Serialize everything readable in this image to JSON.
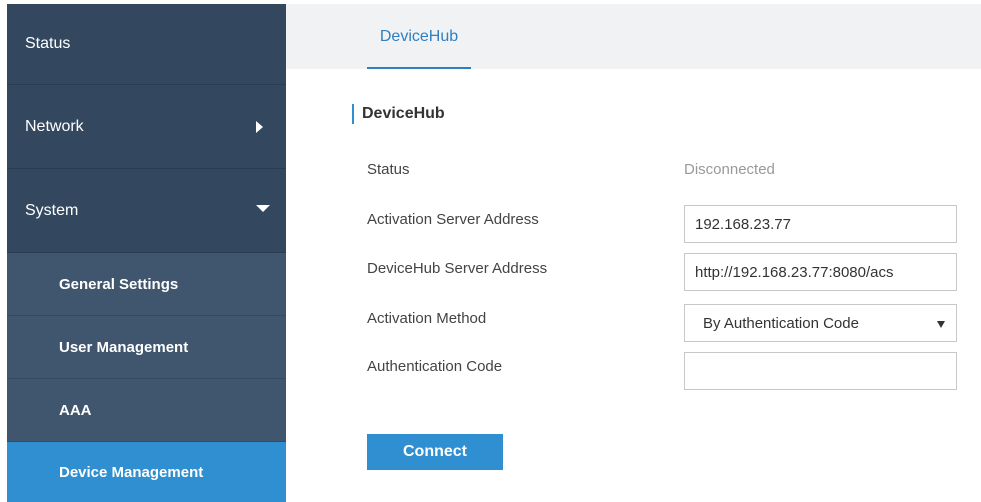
{
  "sidebar": {
    "items": [
      {
        "label": "Status"
      },
      {
        "label": "Network"
      },
      {
        "label": "System"
      },
      {
        "label": "General Settings"
      },
      {
        "label": "User Management"
      },
      {
        "label": "AAA"
      },
      {
        "label": "Device Management"
      }
    ],
    "active": "Device Management"
  },
  "tabs": [
    {
      "label": "DeviceHub",
      "selected": true
    }
  ],
  "section": {
    "title": "DeviceHub"
  },
  "form": {
    "status_label": "Status",
    "status_value": "Disconnected",
    "activation_server_label": "Activation Server Address",
    "activation_server_value": "192.168.23.77",
    "devicehub_server_label": "DeviceHub Server Address",
    "devicehub_server_value": "http://192.168.23.77:8080/acs",
    "activation_method_label": "Activation Method",
    "activation_method_value": "By Authentication Code",
    "auth_code_label": "Authentication Code",
    "auth_code_value": ""
  },
  "connect_button": "Connect",
  "colors": {
    "sidebar_bg": "#33485f",
    "sub_item_bg": "#40566e",
    "active_bg": "#2f8fd0",
    "accent": "#2e7fc3"
  },
  "icons": {
    "network": "chevron-right-icon",
    "system": "chevron-down-icon",
    "select": "caret-down-icon"
  }
}
